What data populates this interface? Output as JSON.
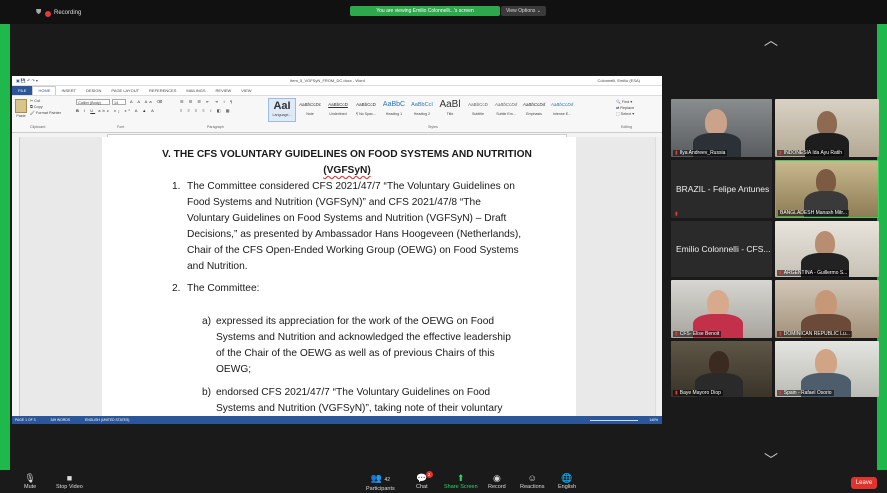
{
  "zoom_bar": {
    "recording_label": "Recording",
    "viewing_banner": "You are viewing Emilio Colonnelli...'s screen",
    "view_options": "View Options ⌄"
  },
  "word": {
    "window_title": "Item_5_VGFSyN_FROM_DC.docx - Word",
    "user": "Colonnelli, Emilio (ESA)",
    "tabs": [
      "FILE",
      "HOME",
      "INSERT",
      "DESIGN",
      "PAGE LAYOUT",
      "REFERENCES",
      "MAILINGS",
      "REVIEW",
      "VIEW"
    ],
    "clipboard": {
      "paste": "Paste",
      "cut": "Cut",
      "copy": "Copy",
      "format_painter": "Format Painter",
      "label": "Clipboard"
    },
    "font": {
      "name": "Calibri (Body)",
      "size": "14",
      "label": "Font"
    },
    "paragraph_label": "Paragraph",
    "styles_label": "Styles",
    "editing": {
      "find": "Find ▾",
      "replace": "Replace",
      "select": "Select ▾",
      "label": "Editing"
    },
    "styles": [
      {
        "sample": "AaI",
        "name": "Language..."
      },
      {
        "sample": "AaBbCcDc",
        "name": "Note"
      },
      {
        "sample": "AaBbCcD",
        "name": "Underlined"
      },
      {
        "sample": "AaBbCcD",
        "name": "¶ No Spac..."
      },
      {
        "sample": "AaBbC",
        "name": "Heading 1"
      },
      {
        "sample": "AaBbCcI",
        "name": "Heading 2"
      },
      {
        "sample": "AaBl",
        "name": "Title"
      },
      {
        "sample": "AaBbCcD",
        "name": "Subtitle"
      },
      {
        "sample": "AaBbCcDd",
        "name": "Subtle Em..."
      },
      {
        "sample": "AaBbCcDd",
        "name": "Emphasis"
      },
      {
        "sample": "AaBbCcDd",
        "name": "Intense E..."
      }
    ],
    "status": {
      "page": "PAGE 1 OF 3",
      "words": "349 WORDS",
      "language": "ENGLISH (UNITED STATES)",
      "zoom": "140%"
    }
  },
  "document": {
    "heading": [
      "V. THE CFS VOLUNTARY GUIDELINES ON FOOD SYSTEMS AND NUTRITION",
      "(VGFSyN)"
    ],
    "item1_num": "1.",
    "item1_lines": [
      "The Committee considered CFS 2021/47/7 “The Voluntary Guidelines on",
      "Food Systems and Nutrition (VGFSyN)” and CFS 2021/47/8 “The",
      "Voluntary Guidelines on Food Systems and Nutrition (VGFSyN) – Draft",
      "Decisions,” as presented by Ambassador Hans Hoogeveen (Netherlands),",
      "Chair of the CFS Open-Ended Working Group (OEWG) on Food Systems",
      "and Nutrition."
    ],
    "item2_num": "2.",
    "item2_text": "The Committee:",
    "sub_a_label": "a)",
    "sub_a_lines": [
      "expressed its appreciation for the work of the OEWG on Food",
      "Systems and Nutrition and acknowledged the effective leadership",
      "of the Chair of the OEWG as well as of previous Chairs of this",
      "OEWG;"
    ],
    "sub_b_label": "b)",
    "sub_b_lines": [
      "endorsed CFS 2021/47/7 “The Voluntary Guidelines on Food",
      "Systems and Nutrition (VGFSyN)”, taking note of their voluntary"
    ]
  },
  "participants": [
    {
      "name": "Ilya Andreev_Russia"
    },
    {
      "name": "INDONESIA Ida Ayu Ratih"
    },
    {
      "name": "BRAZIL - Felipe Antunes"
    },
    {
      "name": "BANGLADESH Manash Mitr..."
    },
    {
      "name": "Emilio Colonnelli - CFS..."
    },
    {
      "name": "ARGENTINA - Guillermo S..."
    },
    {
      "name": "CFS- Elise Benoit"
    },
    {
      "name": "DOMINICAN REPUBLIC Lu..."
    },
    {
      "name": "Baye Mayoro Diop"
    },
    {
      "name": "Spain - Rafael Osorio"
    }
  ],
  "toolbar": {
    "mute": "Mute",
    "video": "Stop Video",
    "participants": "Participants",
    "participants_count": "42",
    "chat": "Chat",
    "chat_badge": "2",
    "share": "Share Screen",
    "record": "Record",
    "reactions": "Reactions",
    "english": "English",
    "leave": "Leave"
  },
  "colors": {
    "zoom_green": "#1fb84a",
    "word_blue": "#2b579a",
    "leave_red": "#e0332c"
  }
}
